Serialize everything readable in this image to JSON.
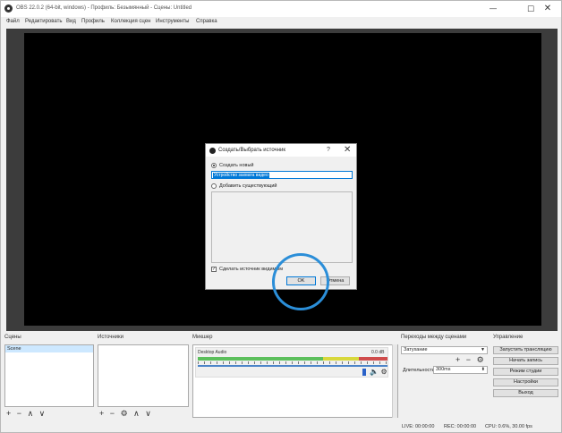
{
  "window": {
    "title": "OBS 22.0.2 (64-bit, windows) - Профиль: Безымянный - Сцены: Untitled",
    "minimize_glyph": "—",
    "maximize_glyph": "☐",
    "close_glyph": "✕"
  },
  "menu": {
    "items": [
      "Файл",
      "Редактировать",
      "Вид",
      "Профиль",
      "Коллекция сцен",
      "Инструменты",
      "Справка"
    ]
  },
  "dialog": {
    "title": "Создать/Выбрать источник",
    "help": "?",
    "close": "✕",
    "option_new": "Создать новый",
    "name_value": "Устройство захвата видео",
    "option_existing": "Добавить существующий",
    "visible_checkbox_mark": "✓",
    "visible_label": "Сделать источник видимым",
    "ok": "OK",
    "cancel": "Отмена"
  },
  "docks": {
    "scenes": {
      "title": "Сцены",
      "items": [
        "Scene"
      ],
      "toolbar": [
        "+",
        "−",
        "∧",
        "∨"
      ]
    },
    "sources": {
      "title": "Источники",
      "toolbar": [
        "+",
        "−",
        "⚙",
        "∧",
        "∨"
      ]
    },
    "mixer": {
      "title": "Микшер",
      "track_name": "Desktop Audio",
      "track_db": "0.0 dB",
      "speaker_glyph": "🔈",
      "gear_glyph": "⚙"
    },
    "transitions": {
      "title": "Переходы между сценами",
      "selected": "Затухание",
      "add": "+",
      "remove": "−",
      "gear": "⚙",
      "duration_label": "Длительность",
      "duration_value": "300ms"
    },
    "controls": {
      "title": "Управление",
      "buttons": [
        "Запустить трансляцию",
        "Начать запись",
        "Режим студии",
        "Настройки",
        "Выход"
      ]
    }
  },
  "status": {
    "live": "LIVE: 00:00:00",
    "rec": "REC: 00:00:00",
    "cpu": "CPU: 0.6%, 30.00 fps"
  },
  "colors": {
    "accent": "#0078d7",
    "highlight_ring": "#2b8ed8",
    "canvas": "#000000",
    "preview_bg": "#3c3c3c",
    "scene_selected": "#cde8ff"
  }
}
